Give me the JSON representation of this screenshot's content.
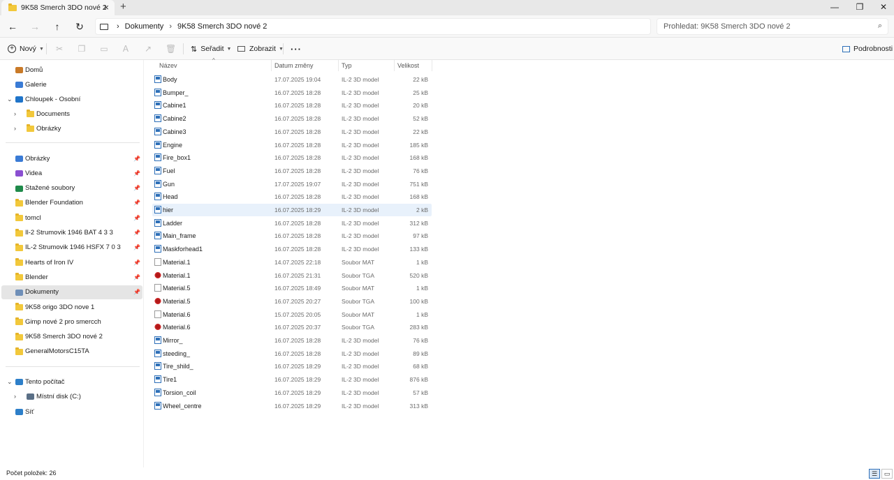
{
  "window": {
    "tab_title": "9K58 Smerch 3DO nové 2",
    "tab_close": "×",
    "new_tab": "+",
    "controls": {
      "minimize": "—",
      "maximize": "❐",
      "close": "✕"
    }
  },
  "nav": {
    "back": "←",
    "forward": "→",
    "up": "↑",
    "refresh": "↻",
    "breadcrumb": [
      "Dokumenty",
      "9K58 Smerch 3DO nové 2"
    ],
    "separator": "›",
    "search_placeholder": "Prohledat: 9K58 Smerch 3DO nové 2",
    "search_icon": "⌕"
  },
  "toolbar": {
    "new_label": "Nový",
    "sort_label": "Seřadit",
    "view_label": "Zobrazit",
    "more_label": "···",
    "details_label": "Podrobnosti",
    "icons": [
      "cut-icon",
      "copy-icon",
      "paste-icon",
      "rename-icon",
      "share-icon",
      "delete-icon"
    ]
  },
  "sidebar": {
    "top": [
      {
        "label": "Domů",
        "icon": "home-icon"
      },
      {
        "label": "Galerie",
        "icon": "gallery-icon"
      },
      {
        "label": "Chloupek - Osobní",
        "icon": "cloud-icon",
        "expanded": true
      },
      {
        "label": "Documents",
        "icon": "folder-icon",
        "child": true
      },
      {
        "label": "Obrázky",
        "icon": "folder-icon",
        "child": true
      }
    ],
    "pinned": [
      {
        "label": "Obrázky",
        "icon": "pictures-icon",
        "pinned": true
      },
      {
        "label": "Videa",
        "icon": "videos-icon",
        "pinned": true
      },
      {
        "label": "Stažené soubory",
        "icon": "download-icon",
        "pinned": true
      },
      {
        "label": "Blender Foundation",
        "icon": "folder-icon",
        "pinned": true
      },
      {
        "label": "tomcl",
        "icon": "folder-icon",
        "pinned": true
      },
      {
        "label": "Il-2 Strumovik 1946 BAT 4 3 3",
        "icon": "folder-icon",
        "pinned": true
      },
      {
        "label": "IL-2 Strumovik 1946 HSFX 7 0 3",
        "icon": "folder-icon",
        "pinned": true
      },
      {
        "label": "Hearts of Iron IV",
        "icon": "folder-icon",
        "pinned": true
      },
      {
        "label": "Blender",
        "icon": "folder-icon",
        "pinned": true
      },
      {
        "label": "Dokumenty",
        "icon": "documents-icon",
        "pinned": true,
        "selected": true
      },
      {
        "label": "9K58 origo 3DO nove 1",
        "icon": "folder-icon"
      },
      {
        "label": "Gimp nové 2 pro smercch",
        "icon": "folder-icon"
      },
      {
        "label": "9K58 Smerch 3DO nové 2",
        "icon": "folder-icon"
      },
      {
        "label": "GeneralMotorsC15TA",
        "icon": "folder-icon"
      }
    ],
    "bottom": [
      {
        "label": "Tento počítač",
        "icon": "computer-icon",
        "expanded": true
      },
      {
        "label": "Místní disk (C:)",
        "icon": "drive-icon",
        "child": true
      },
      {
        "label": "Síť",
        "icon": "network-icon"
      }
    ]
  },
  "columns": {
    "name": "Název",
    "date": "Datum změny",
    "type": "Typ",
    "size": "Velikost"
  },
  "files": [
    {
      "name": "Body",
      "date": "17.07.2025 19:04",
      "type": "IL-2 3D model",
      "size": "22 kB",
      "kind": "3d"
    },
    {
      "name": "Bumper_",
      "date": "16.07.2025 18:28",
      "type": "IL-2 3D model",
      "size": "25 kB",
      "kind": "3d"
    },
    {
      "name": "Cabine1",
      "date": "16.07.2025 18:28",
      "type": "IL-2 3D model",
      "size": "20 kB",
      "kind": "3d"
    },
    {
      "name": "Cabine2",
      "date": "16.07.2025 18:28",
      "type": "IL-2 3D model",
      "size": "52 kB",
      "kind": "3d"
    },
    {
      "name": "Cabine3",
      "date": "16.07.2025 18:28",
      "type": "IL-2 3D model",
      "size": "22 kB",
      "kind": "3d"
    },
    {
      "name": "Engine",
      "date": "16.07.2025 18:28",
      "type": "IL-2 3D model",
      "size": "185 kB",
      "kind": "3d"
    },
    {
      "name": "Fire_box1",
      "date": "16.07.2025 18:28",
      "type": "IL-2 3D model",
      "size": "168 kB",
      "kind": "3d"
    },
    {
      "name": "Fuel",
      "date": "16.07.2025 18:28",
      "type": "IL-2 3D model",
      "size": "76 kB",
      "kind": "3d"
    },
    {
      "name": "Gun",
      "date": "17.07.2025 19:07",
      "type": "IL-2 3D model",
      "size": "751 kB",
      "kind": "3d"
    },
    {
      "name": "Head",
      "date": "16.07.2025 18:28",
      "type": "IL-2 3D model",
      "size": "168 kB",
      "kind": "3d"
    },
    {
      "name": "hier",
      "date": "16.07.2025 18:29",
      "type": "IL-2 3D model",
      "size": "2 kB",
      "kind": "3d",
      "highlight": true
    },
    {
      "name": "Ladder",
      "date": "16.07.2025 18:28",
      "type": "IL-2 3D model",
      "size": "312 kB",
      "kind": "3d"
    },
    {
      "name": "Main_frame",
      "date": "16.07.2025 18:28",
      "type": "IL-2 3D model",
      "size": "97 kB",
      "kind": "3d"
    },
    {
      "name": "Maskforhead1",
      "date": "16.07.2025 18:28",
      "type": "IL-2 3D model",
      "size": "133 kB",
      "kind": "3d"
    },
    {
      "name": "Material.1",
      "date": "14.07.2025 22:18",
      "type": "Soubor MAT",
      "size": "1 kB",
      "kind": "mat"
    },
    {
      "name": "Material.1",
      "date": "16.07.2025 21:31",
      "type": "Soubor TGA",
      "size": "520 kB",
      "kind": "tga"
    },
    {
      "name": "Material.5",
      "date": "16.07.2025 18:49",
      "type": "Soubor MAT",
      "size": "1 kB",
      "kind": "mat"
    },
    {
      "name": "Material.5",
      "date": "16.07.2025 20:27",
      "type": "Soubor TGA",
      "size": "100 kB",
      "kind": "tga"
    },
    {
      "name": "Material.6",
      "date": "15.07.2025 20:05",
      "type": "Soubor MAT",
      "size": "1 kB",
      "kind": "mat"
    },
    {
      "name": "Material.6",
      "date": "16.07.2025 20:37",
      "type": "Soubor TGA",
      "size": "283 kB",
      "kind": "tga"
    },
    {
      "name": "Mirror_",
      "date": "16.07.2025 18:28",
      "type": "IL-2 3D model",
      "size": "76 kB",
      "kind": "3d"
    },
    {
      "name": "steeding_",
      "date": "16.07.2025 18:28",
      "type": "IL-2 3D model",
      "size": "89 kB",
      "kind": "3d"
    },
    {
      "name": "Tire_shild_",
      "date": "16.07.2025 18:29",
      "type": "IL-2 3D model",
      "size": "68 kB",
      "kind": "3d"
    },
    {
      "name": "Tire1",
      "date": "16.07.2025 18:29",
      "type": "IL-2 3D model",
      "size": "876 kB",
      "kind": "3d"
    },
    {
      "name": "Torsion_coil",
      "date": "16.07.2025 18:29",
      "type": "IL-2 3D model",
      "size": "57 kB",
      "kind": "3d"
    },
    {
      "name": "Wheel_centre",
      "date": "16.07.2025 18:29",
      "type": "IL-2 3D model",
      "size": "313 kB",
      "kind": "3d"
    }
  ],
  "status": {
    "count_text": "Počet položek: 26"
  },
  "colors": {
    "accent": "#2d6fb8",
    "folder": "#f2c83b",
    "selected_row": "#e8f1fb",
    "selected_nav": "#e5e5e5"
  }
}
